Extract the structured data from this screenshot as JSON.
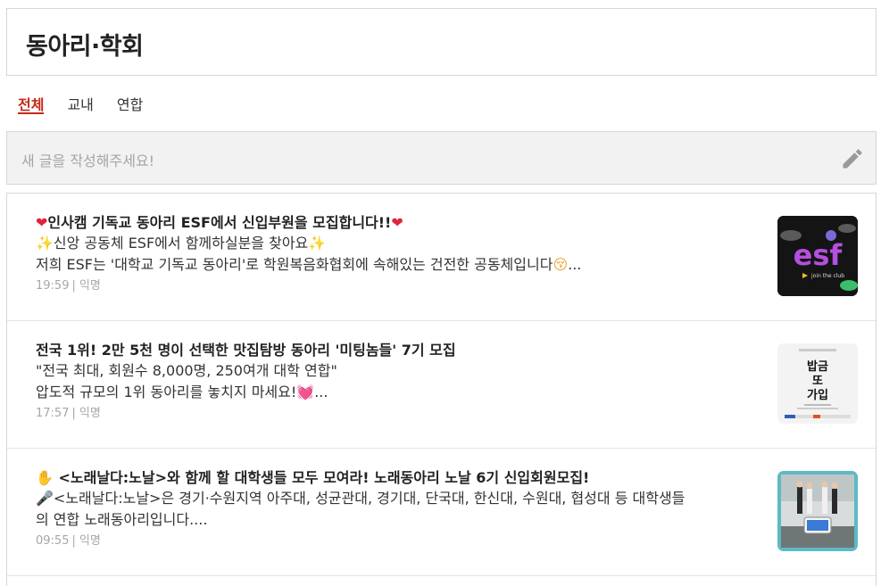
{
  "board": {
    "title": "동아리·학회"
  },
  "tabs": [
    {
      "label": "전체",
      "active": true
    },
    {
      "label": "교내",
      "active": false
    },
    {
      "label": "연합",
      "active": false
    }
  ],
  "write": {
    "placeholder": "새 글을 작성해주세요!",
    "icon": "pencil-icon"
  },
  "posts": [
    {
      "title_prefix": "❤",
      "title": "인사캠 기독교 동아리 ESF에서 신입부원을 모집합니다!!",
      "title_suffix": "❤",
      "line1_prefix": "✨",
      "line1": "신앙 공동체 ESF에서 함께하실분을 찾아요",
      "line1_suffix": "✨",
      "line2": "저희 ESF는 '대학교 기독교 동아리'로 학원복음화협회에 속해있는 건전한 공동체입니다",
      "line2_emoji": "😚",
      "line2_ellipsis": "...",
      "time": "19:59",
      "author": "익명",
      "thumb_text": "esf",
      "thumb_caption": "join the club"
    },
    {
      "title": "전국 1위! 2만 5천 명이 선택한 맛집탐방 동아리 '미팅놈들' 7기 모집",
      "line1": "\"전국 최대, 회원수 8,000명, 250여개 대학 연합\"",
      "line2": "압도적 규모의 1위 동아리를 놓치지 마세요!",
      "line2_emoji": "💓",
      "line2_ellipsis": "...",
      "time": "17:57",
      "author": "익명",
      "thumb_text_1": "밥금",
      "thumb_text_2": "또",
      "thumb_text_3": "가입"
    },
    {
      "title_prefix": "✋",
      "title": "<노래날다:노날>와 함께 할 대학생들 모두 모여라! 노래동아리 노날 6기 신입회원모집!",
      "line1_prefix": "🎤",
      "line1": "<노래날다:노날>은 경기·수원지역 아주대, 성균관대, 경기대, 단국대, 한신대, 수원대, 협성대 등 대학생들",
      "line2": "의 연합 노래동아리입니다....",
      "time": "09:55",
      "author": "익명"
    }
  ],
  "colors": {
    "accent": "#c62917",
    "meta": "#a6a6a6",
    "border": "#d6d6d6"
  }
}
